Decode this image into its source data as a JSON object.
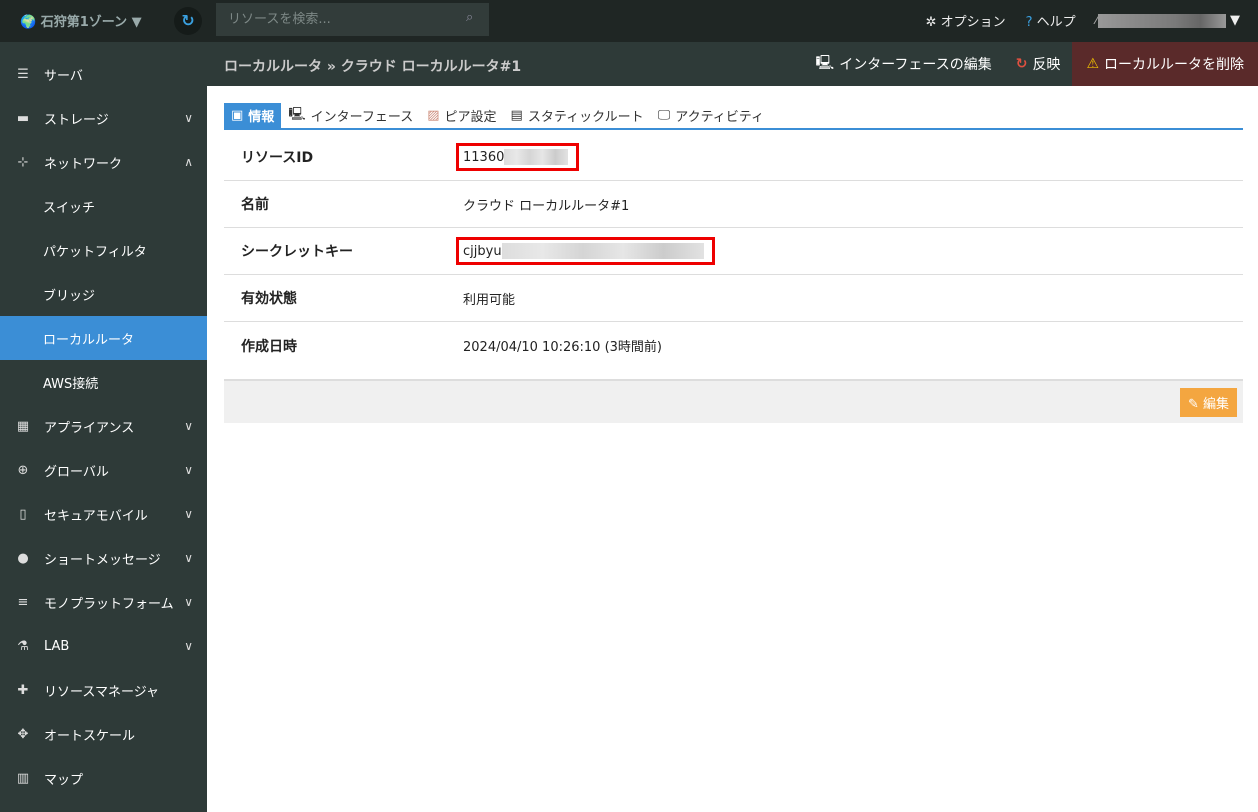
{
  "topbar": {
    "zone": "石狩第1ゾーン ▼",
    "search_placeholder": "リソースを検索...",
    "options": "オプション",
    "help": "ヘルプ"
  },
  "sidebar": {
    "items": [
      {
        "label": "サーバ",
        "icon": "server-icon"
      },
      {
        "label": "ストレージ",
        "icon": "storage-icon"
      },
      {
        "label": "ネットワーク",
        "icon": "network-icon"
      },
      {
        "label": "スイッチ"
      },
      {
        "label": "パケットフィルタ"
      },
      {
        "label": "ブリッジ"
      },
      {
        "label": "ローカルルータ"
      },
      {
        "label": "AWS接続"
      },
      {
        "label": "アプライアンス",
        "icon": "grid-icon"
      },
      {
        "label": "グローバル",
        "icon": "globe-icon"
      },
      {
        "label": "セキュアモバイル",
        "icon": "mobile-icon"
      },
      {
        "label": "ショートメッセージ",
        "icon": "chat-icon"
      },
      {
        "label": "モノプラットフォーム",
        "icon": "list-icon"
      },
      {
        "label": "LAB",
        "icon": "flask-icon"
      },
      {
        "label": "リソースマネージャ",
        "icon": "puzzle-icon"
      },
      {
        "label": "オートスケール",
        "icon": "move-icon"
      },
      {
        "label": "マップ",
        "icon": "map-icon"
      }
    ]
  },
  "header": {
    "breadcrumb": "ローカルルータ » クラウド ローカルルータ#1",
    "edit_interfaces": "インターフェースの編集",
    "apply": "反映",
    "delete": "ローカルルータを削除"
  },
  "tabs": [
    "情報",
    "インターフェース",
    "ピア設定",
    "スタティックルート",
    "アクティビティ"
  ],
  "info": {
    "rows": [
      {
        "label": "リソースID",
        "value": "11360"
      },
      {
        "label": "名前",
        "value": "クラウド ローカルルータ#1"
      },
      {
        "label": "シークレットキー",
        "value": "cjjbyu"
      },
      {
        "label": "有効状態",
        "value": "利用可能"
      },
      {
        "label": "作成日時",
        "value": "2024/04/10 10:26:10 (3時間前)"
      }
    ]
  },
  "edit_label": "編集",
  "colors": {
    "accent": "#3b8ed6",
    "delete_bg": "#5a2a2a",
    "edit_button": "#f4a640",
    "highlight": "#ee0000"
  }
}
